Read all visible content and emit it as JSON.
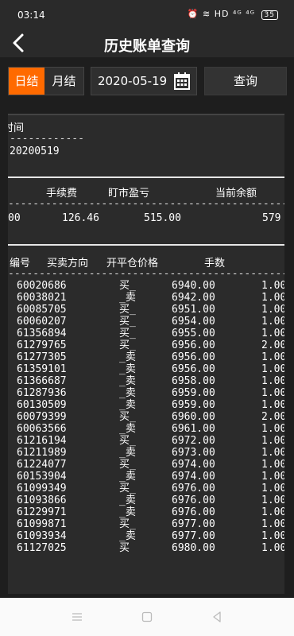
{
  "status": {
    "time": "03:14",
    "icons": "⏰ ≋ HD ⁴ᴳ ⁴ᴳ",
    "battery": "35"
  },
  "header": {
    "title": "历史账单查询"
  },
  "toolbar": {
    "daily": "日结",
    "monthly": "月结",
    "date": "2020-05-19",
    "query": "查询"
  },
  "section1": {
    "label": "时间",
    "dashes": "------------",
    "value": "20200519"
  },
  "section2": {
    "columns": [
      "手续费",
      "盯市盈亏",
      "当前余额"
    ],
    "dashes": "--------------------------------------------------",
    "values": [
      "00",
      "126.46",
      "515.00",
      "579"
    ]
  },
  "table": {
    "columns": [
      "编号",
      "买卖方向",
      "开平仓价格",
      "手数"
    ],
    "dashes": "--------------------------------------------------",
    "rows": [
      [
        "60020686",
        "买_",
        "6940.00",
        "1.00"
      ],
      [
        "60038021",
        "_卖",
        "6942.00",
        "1.00"
      ],
      [
        "60085705",
        "买_",
        "6951.00",
        "1.00"
      ],
      [
        "60060207",
        "买_",
        "6954.00",
        "1.00"
      ],
      [
        "61356894",
        "买_",
        "6955.00",
        "1.00"
      ],
      [
        "61279765",
        "买_",
        "6956.00",
        "2.00"
      ],
      [
        "61277305",
        "_卖",
        "6956.00",
        "1.00"
      ],
      [
        "61359101",
        "_卖",
        "6956.00",
        "1.00"
      ],
      [
        "61366687",
        "_卖",
        "6958.00",
        "1.00"
      ],
      [
        "61287936",
        "_卖",
        "6959.00",
        "1.00"
      ],
      [
        "60130509",
        "_卖",
        "6959.00",
        "1.00"
      ],
      [
        "60079399",
        "买_",
        "6960.00",
        "2.00"
      ],
      [
        "60063566",
        "_卖",
        "6961.00",
        "1.00"
      ],
      [
        "61216194",
        "买_",
        "6972.00",
        "1.00"
      ],
      [
        "61211989",
        "_卖",
        "6973.00",
        "1.00"
      ],
      [
        "61224077",
        "买_",
        "6974.00",
        "1.00"
      ],
      [
        "60153904",
        "_卖",
        "6974.00",
        "1.00"
      ],
      [
        "61099349",
        "买_",
        "6976.00",
        "1.00"
      ],
      [
        "61093866",
        "_卖",
        "6976.00",
        "1.00"
      ],
      [
        "61229971",
        "_卖",
        "6976.00",
        "1.00"
      ],
      [
        "61099871",
        "买_",
        "6977.00",
        "1.00"
      ],
      [
        "61093934",
        "_卖",
        "6977.00",
        "1.00"
      ],
      [
        "61127025",
        "买",
        "6980.00",
        "1.00"
      ]
    ]
  },
  "nav": {
    "menu": "menu-icon",
    "home": "home-icon",
    "back": "back-icon"
  },
  "colors": {
    "accent": "#ff6a00",
    "background": "#1e1e1e",
    "panel": "#2b2b2b"
  }
}
